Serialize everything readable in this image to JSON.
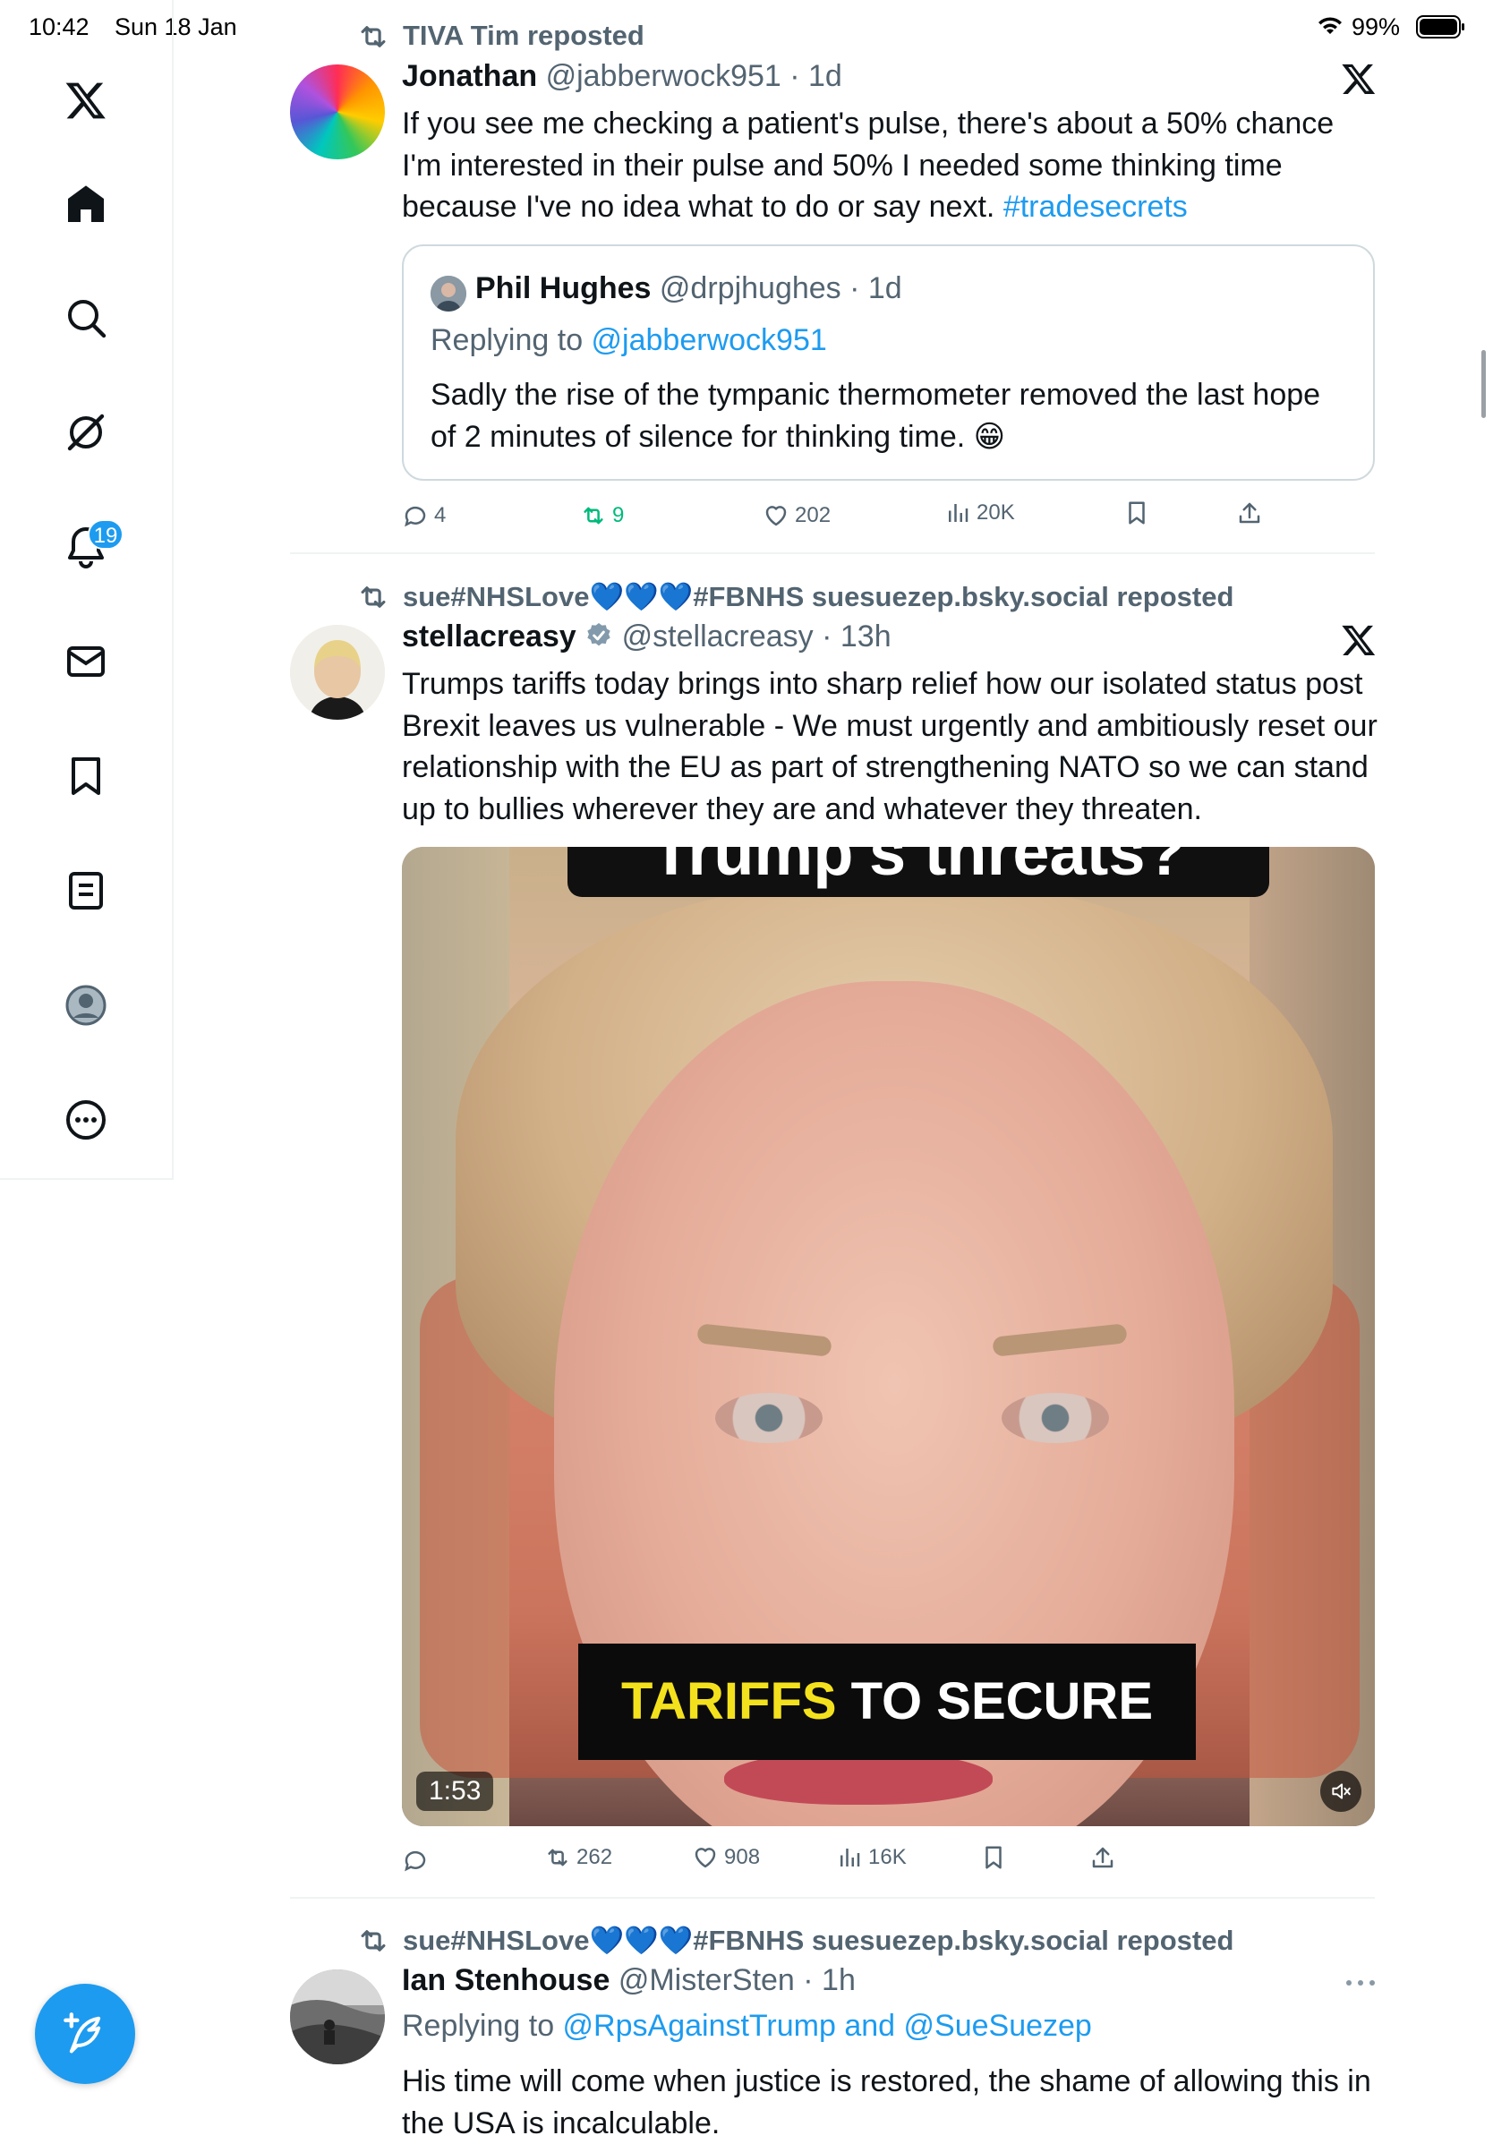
{
  "status_bar": {
    "time": "10:42",
    "date": "Sun 18 Jan",
    "battery": "99%"
  },
  "sidebar": {
    "items": [
      {
        "name": "x-logo-icon"
      },
      {
        "name": "home-icon"
      },
      {
        "name": "search-icon"
      },
      {
        "name": "grok-icon"
      },
      {
        "name": "notifications-icon",
        "badge": "19"
      },
      {
        "name": "messages-icon"
      },
      {
        "name": "bookmarks-icon"
      },
      {
        "name": "lists-icon"
      },
      {
        "name": "profile-icon"
      },
      {
        "name": "more-icon"
      }
    ],
    "notification_badge": "19"
  },
  "feed": {
    "post1": {
      "repost_label": "TIVA Tim reposted",
      "author_name": "Jonathan",
      "handle_time": "@jabberwock951 · 1d",
      "text": "If you see me checking a patient's pulse, there's about a 50% chance I'm interested in their pulse and 50% I needed some thinking time because I've no idea what to do or say next. ",
      "hashtag": "#tradesecrets",
      "quote": {
        "author_name": "Phil Hughes",
        "handle_time": "@drpjhughes · 1d",
        "replying_prefix": "Replying to ",
        "replying_handle": "@jabberwock951",
        "text": "Sadly the rise of the tympanic thermometer removed the last hope of 2 minutes of silence for thinking time.",
        "emoji": "😁"
      },
      "actions": {
        "replies": "4",
        "reposts": "9",
        "likes": "202",
        "views": "20K"
      }
    },
    "post2": {
      "repost_label": "sue#NHSLove💙💙💙#FBNHS suesuezep.bsky.social reposted",
      "author_name": "stellacreasy",
      "handle_time": "@stellacreasy · 13h",
      "text": "Trumps tariffs today brings into sharp relief how our isolated status post Brexit leaves us vulnerable - We must urgently and ambitiously reset our relationship with the EU as part of strengthening NATO so we can stand up to bullies wherever they are and whatever they threaten.",
      "video": {
        "caption_top": "Trump's threats?",
        "caption_yellow": "TARIFFS",
        "caption_white": " TO SECURE",
        "duration": "1:53"
      },
      "actions": {
        "replies": "",
        "reposts": "262",
        "likes": "908",
        "views": "16K"
      }
    },
    "post3": {
      "repost_label": "sue#NHSLove💙💙💙#FBNHS suesuezep.bsky.social reposted",
      "author_name": "Ian Stenhouse",
      "handle_time": "@MisterSten · 1h",
      "replying_prefix": "Replying to ",
      "replying_handles": "@RpsAgainstTrump and @SueSuezep",
      "text": "His time will come when justice is restored, the shame of allowing this in the USA is incalculable."
    }
  },
  "colors": {
    "accent": "#1d9bf0",
    "repost_green": "#00ba7c",
    "secondary_text": "#536471",
    "border": "#cfd9de"
  }
}
